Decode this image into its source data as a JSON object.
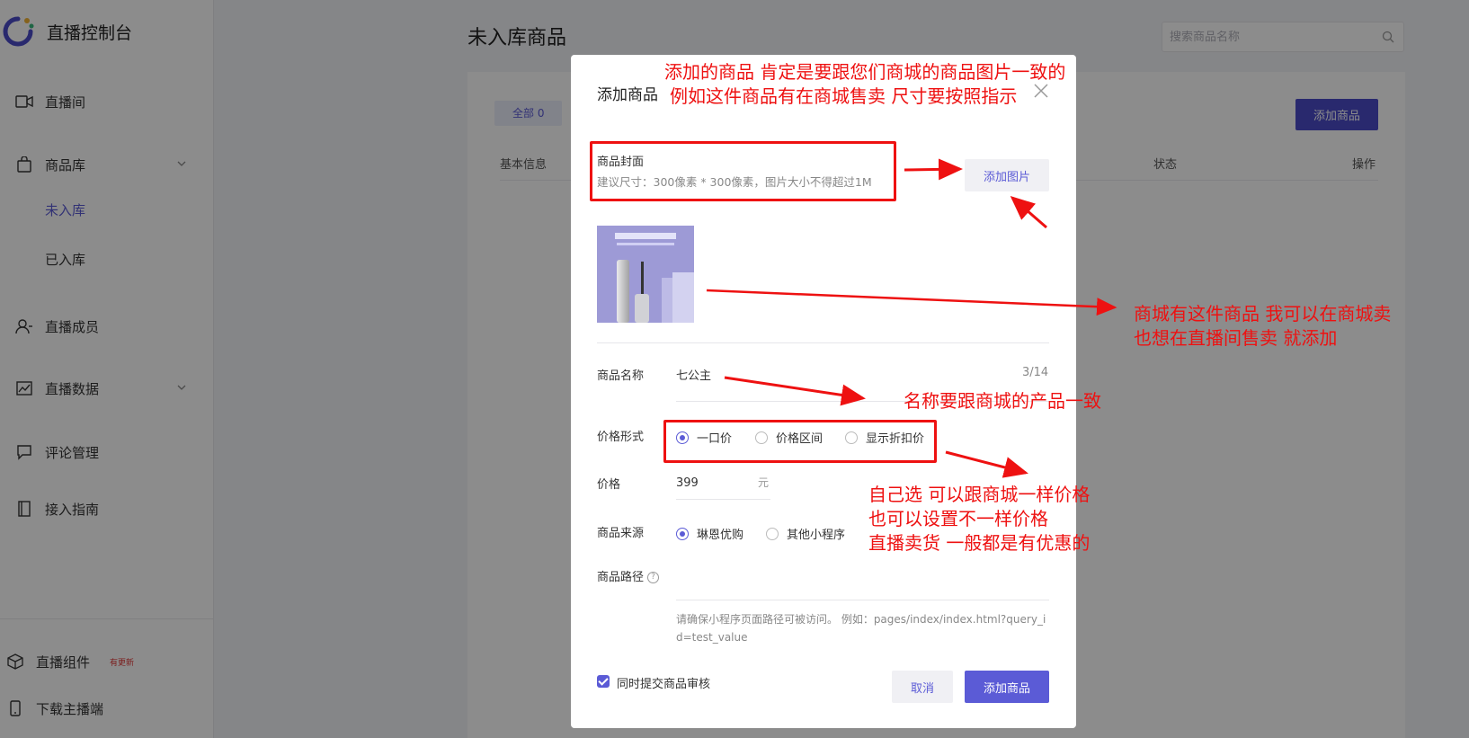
{
  "sidebar": {
    "brand_title": "直播控制台",
    "items": [
      {
        "label": "直播间"
      },
      {
        "label": "商品库"
      },
      {
        "label": "未入库"
      },
      {
        "label": "已入库"
      },
      {
        "label": "直播成员"
      },
      {
        "label": "直播数据"
      },
      {
        "label": "评论管理"
      },
      {
        "label": "接入指南"
      }
    ],
    "bottom": [
      {
        "label": "直播组件",
        "badge": "有更新"
      },
      {
        "label": "下载主播端"
      }
    ]
  },
  "page": {
    "title": "未入库商品",
    "search_placeholder": "搜索商品名称",
    "tab_all": "全部 0",
    "add_button": "添加商品",
    "columns": [
      "基本信息",
      "状态",
      "操作"
    ]
  },
  "modal": {
    "title": "添加商品",
    "cover_label": "商品封面",
    "cover_hint": "建议尺寸：300像素 * 300像素，图片大小不得超过1M",
    "add_image": "添加图片",
    "name_label": "商品名称",
    "name_value": "七公主",
    "name_count": "3/14",
    "price_type_label": "价格形式",
    "price_types": [
      "一口价",
      "价格区间",
      "显示折扣价"
    ],
    "price_label": "价格",
    "price_value": "399",
    "price_unit": "元",
    "source_label": "商品来源",
    "sources": [
      "琳恩优购",
      "其他小程序"
    ],
    "path_label": "商品路径",
    "path_hint": "请确保小程序页面路径可被访问。 例如：pages/index/index.html?query_id=test_value",
    "submit_review": "同时提交商品审核",
    "cancel": "取消",
    "submit": "添加商品"
  },
  "annotations": {
    "top_line1": "添加的商品 肯定是要跟您们商城的商品图片一致的",
    "top_line2": "例如这件商品有在商城售卖  尺寸要按照指示",
    "right_line1": "商城有这件商品 我可以在商城卖",
    "right_line2": "也想在直播间售卖 就添加",
    "name_note": "名称要跟商城的产品一致",
    "price_line1": "自己选 可以跟商城一样价格",
    "price_line2": "也可以设置不一样价格",
    "price_line3": "直播卖货 一般都是有优惠的",
    "color": "#ee1111"
  },
  "colors": {
    "accent": "#5b5bd6",
    "primary_button": "#4b4bc9",
    "annotation_red": "#ee1111"
  }
}
